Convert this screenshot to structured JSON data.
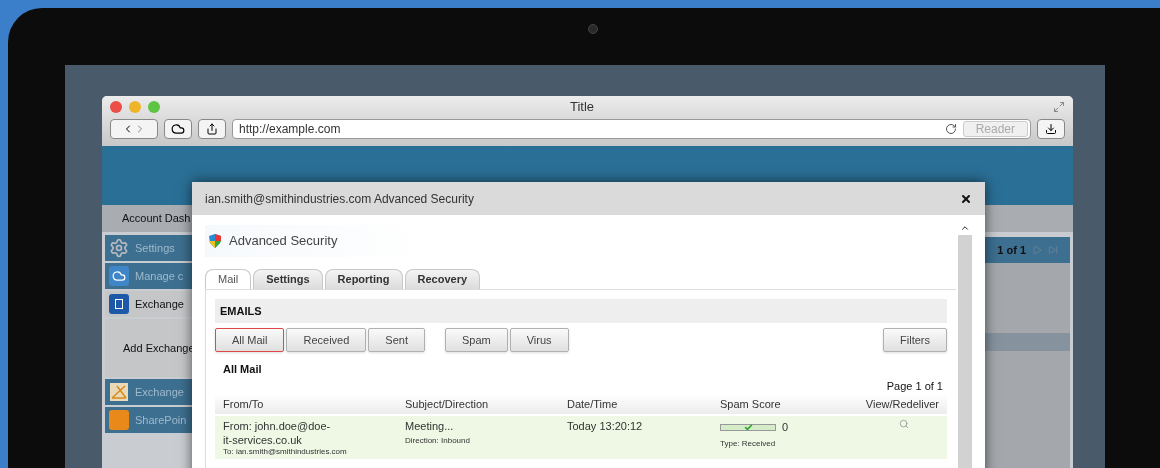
{
  "browser": {
    "title": "Title",
    "url": "http://example.com",
    "reader": "Reader"
  },
  "page": {
    "nav": "Account Dash",
    "pager": "1 of 1",
    "sidebar": [
      {
        "kind": "item",
        "label": "Settings",
        "selected": false
      },
      {
        "kind": "item",
        "label": "Manage c",
        "selected": false
      },
      {
        "kind": "item",
        "label": "Exchange",
        "selected": true
      },
      {
        "kind": "panel",
        "label": "Add Exchange"
      },
      {
        "kind": "item",
        "label": "Exchange",
        "selected": false
      },
      {
        "kind": "item",
        "label": "SharePoin",
        "selected": false
      }
    ]
  },
  "dialog": {
    "title": "ian.smith@smithindustries.com Advanced Security",
    "app_name": "Advanced Security",
    "tabs": [
      {
        "label": "Mail",
        "selected": true
      },
      {
        "label": "Settings",
        "selected": false
      },
      {
        "label": "Reporting",
        "selected": false
      },
      {
        "label": "Recovery",
        "selected": false
      }
    ],
    "section": "EMAILS",
    "direction_filters": [
      {
        "label": "All Mail",
        "selected": true
      },
      {
        "label": "Received",
        "selected": false
      },
      {
        "label": "Sent",
        "selected": false
      }
    ],
    "type_filters": [
      {
        "label": "Spam",
        "selected": false
      },
      {
        "label": "Virus",
        "selected": false
      }
    ],
    "filters_button": "Filters",
    "view_title": "All Mail",
    "page_info": "Page 1 of 1",
    "columns": [
      "From/To",
      "Subject/Direction",
      "Date/Time",
      "Spam Score",
      "View/Redeliver"
    ],
    "rows": [
      {
        "from": "From: john.doe@doe-it-services.co.uk",
        "to": "To: ian.smith@smithindustries.com",
        "subject": "Meeting...",
        "direction": "Direction: Inbound",
        "date": "Today 13:20:12",
        "score": "0",
        "type": "Type: Received"
      }
    ]
  }
}
